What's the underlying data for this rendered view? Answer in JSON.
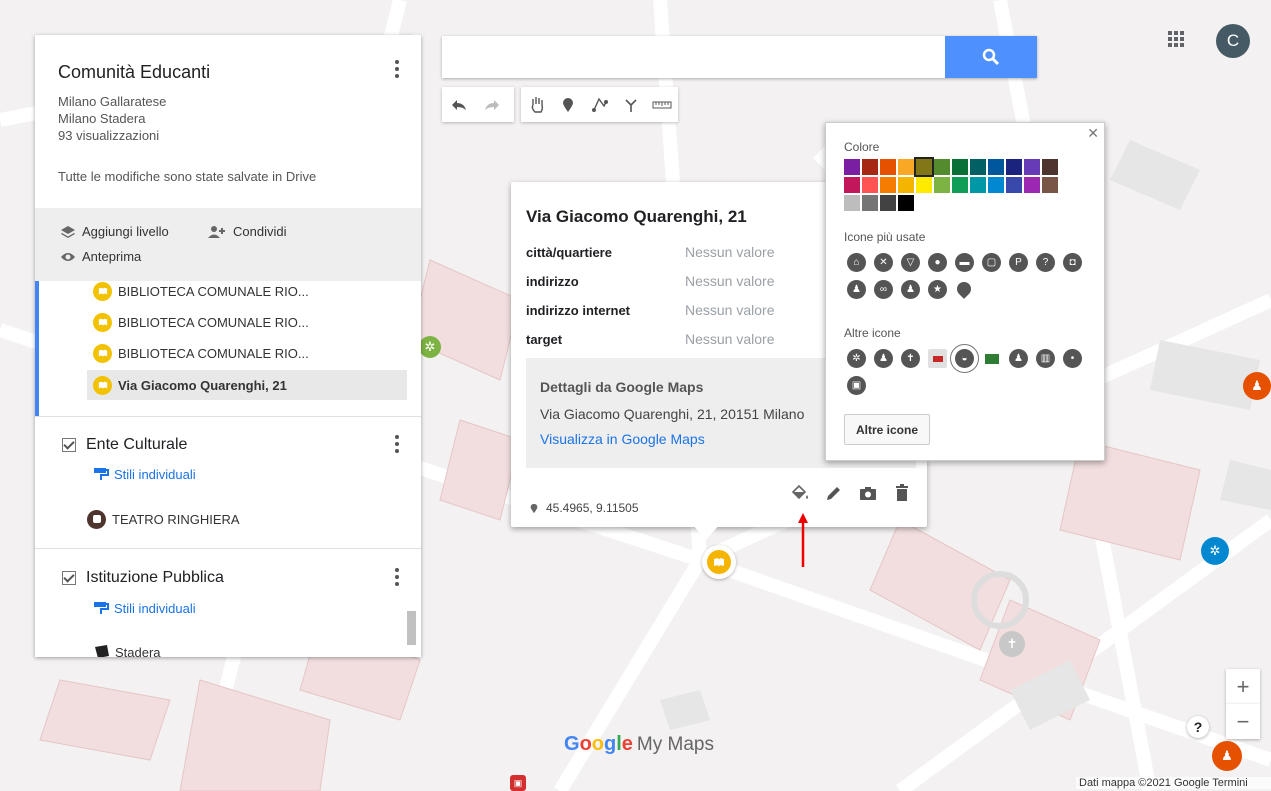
{
  "map_title": "Comunità Educanti",
  "map_subtitles": [
    "Milano Gallaratese",
    "Milano Stadera",
    "93 visualizzazioni"
  ],
  "save_status": "Tutte le modifiche sono state salvate in Drive",
  "actions": {
    "add_layer": "Aggiungi livello",
    "share": "Condividi",
    "preview": "Anteprima"
  },
  "features": [
    "BIBLIOTECA COMUNALE RIO...",
    "BIBLIOTECA COMUNALE RIO...",
    "BIBLIOTECA COMUNALE RIO...",
    "Via Giacomo Quarenghi, 21"
  ],
  "layers": [
    {
      "name": "Ente Culturale",
      "style": "Stili individuali",
      "item": "TEATRO RINGHIERA"
    },
    {
      "name": "Istituzione Pubblica",
      "style": "Stili individuali",
      "item": "Stadera"
    }
  ],
  "toolbar_icons": [
    "undo-icon",
    "redo-icon",
    "hand-icon",
    "marker-icon",
    "line-icon",
    "directions-icon",
    "ruler-icon"
  ],
  "account_initial": "C",
  "card": {
    "title": "Via Giacomo Quarenghi, 21",
    "props": [
      {
        "key": "città/quartiere",
        "value": "Nessun valore"
      },
      {
        "key": "indirizzo",
        "value": "Nessun valore"
      },
      {
        "key": "indirizzo internet",
        "value": "Nessun valore"
      },
      {
        "key": "target",
        "value": "Nessun valore"
      }
    ],
    "gm_title": "Dettagli da Google Maps",
    "gm_address": "Via Giacomo Quarenghi, 21, 20151 Milano",
    "gm_link": "Visualizza in Google Maps",
    "coords": "45.4965, 9.11505"
  },
  "style_popup": {
    "color_label": "Colore",
    "colors": [
      "#7b1fa2",
      "#a52714",
      "#e65100",
      "#f9a825",
      "#817717",
      "#558b2f",
      "#097138",
      "#006064",
      "#01579b",
      "#1a237e",
      "#673ab7",
      "#4e342e",
      "#c2185b",
      "#ff5252",
      "#f57c00",
      "#f4b400",
      "#ffea00",
      "#7cb342",
      "#0f9d58",
      "#0097a7",
      "#0288d1",
      "#3949ab",
      "#9c27b0",
      "#795548",
      "#bdbdbd",
      "#757575",
      "#424242",
      "#000000"
    ],
    "selected_color": "#817717",
    "common_label": "Icone più usate",
    "other_label": "Altre icone",
    "more_button": "Altre icone"
  },
  "map_brand": {
    "google": "Google",
    "mymaps": "My Maps"
  },
  "attribution": "Dati mappa ©2021 Google   Termini",
  "zoom_in": "+",
  "zoom_out": "−",
  "help": "?"
}
